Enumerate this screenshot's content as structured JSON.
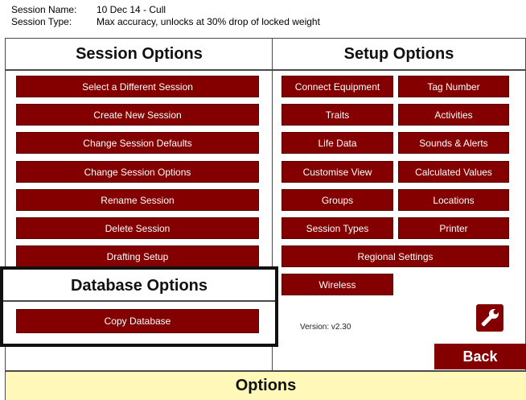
{
  "session": {
    "name_label": "Session Name:",
    "name_value": "10 Dec 14 - Cull",
    "type_label": "Session Type:",
    "type_value": "Max accuracy, unlocks at 30% drop of locked weight"
  },
  "session_options": {
    "title": "Session Options",
    "buttons": [
      "Select a Different Session",
      "Create New Session",
      "Change Session Defaults",
      "Change Session Options",
      "Rename Session",
      "Delete Session",
      "Drafting Setup"
    ]
  },
  "database_options": {
    "title": "Database Options",
    "copy_label": "Copy Database"
  },
  "setup_options": {
    "title": "Setup Options",
    "buttons": [
      "Connect Equipment",
      "Tag Number",
      "Traits",
      "Activities",
      "Life Data",
      "Sounds & Alerts",
      "Customise View",
      "Calculated Values",
      "Groups",
      "Locations",
      "Session Types",
      "Printer",
      "Regional Settings",
      "Wireless"
    ]
  },
  "version": "Version: v2.30",
  "back_label": "Back",
  "footer_title": "Options",
  "icons": {
    "settings": "wrench-icon"
  },
  "colors": {
    "button_bg": "#840000",
    "footer_bg": "#fff8b8"
  }
}
